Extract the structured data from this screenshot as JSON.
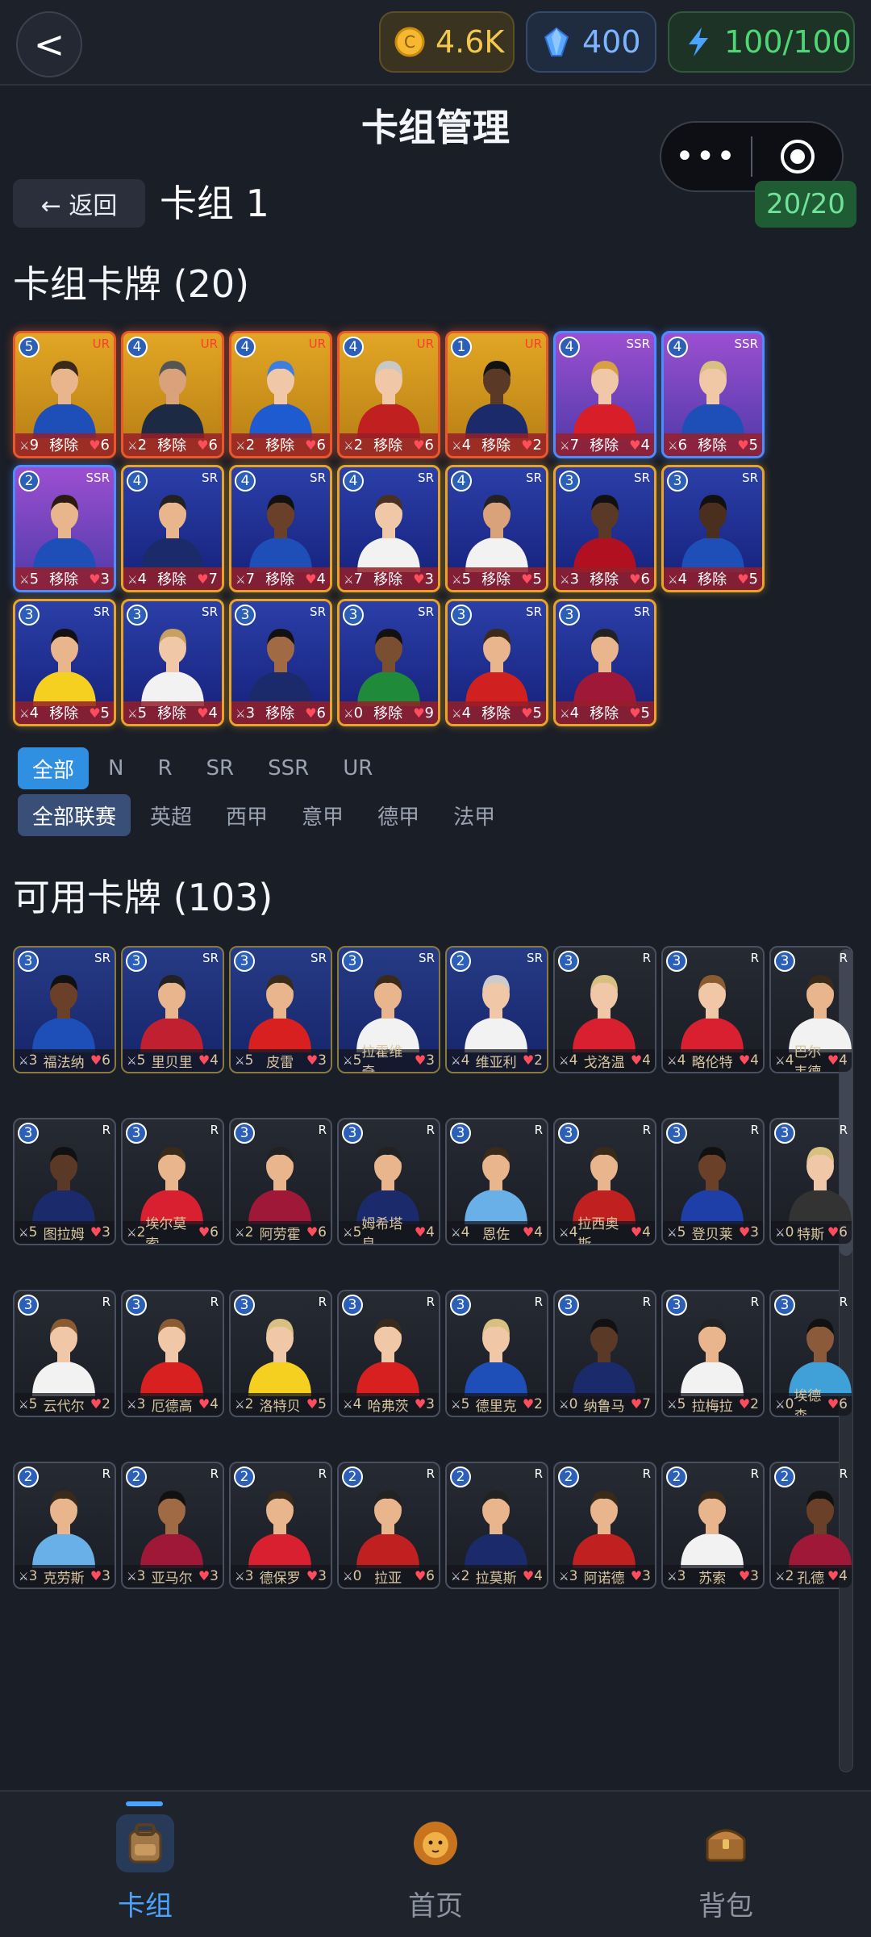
{
  "topbar": {
    "back_icon": "<",
    "coins": "4.6K",
    "gems": "400",
    "energy": "100/100"
  },
  "title": "卡组管理",
  "capsule": {
    "more": "•••"
  },
  "deck_header": {
    "return_label": "← 返回",
    "deck_name": "卡组 1",
    "count": "20/20"
  },
  "deck_section_title": "卡组卡牌 (20)",
  "available_section_title": "可用卡牌 (103)",
  "deck_cards": [
    {
      "level": "5",
      "rarity": "UR",
      "atk": "9",
      "action": "移除",
      "hp": "6",
      "jersey": "#1e4fb8",
      "skin": "#e8b58c",
      "hair": "#3a2a1a"
    },
    {
      "level": "4",
      "rarity": "UR",
      "atk": "2",
      "action": "移除",
      "hp": "6",
      "jersey": "#1c2a44",
      "skin": "#d9a27a",
      "hair": "#555555"
    },
    {
      "level": "4",
      "rarity": "UR",
      "atk": "2",
      "action": "移除",
      "hp": "6",
      "jersey": "#1f5bd0",
      "skin": "#f0c8a8",
      "hair": "#3d7fe0"
    },
    {
      "level": "4",
      "rarity": "UR",
      "atk": "2",
      "action": "移除",
      "hp": "6",
      "jersey": "#c0201f",
      "skin": "#f0c8a8",
      "hair": "#c8c8c8"
    },
    {
      "level": "1",
      "rarity": "UR",
      "atk": "4",
      "action": "移除",
      "hp": "2",
      "jersey": "#1a2a6a",
      "skin": "#5a3a26",
      "hair": "#111111"
    },
    {
      "level": "4",
      "rarity": "SSR",
      "atk": "7",
      "action": "移除",
      "hp": "4",
      "jersey": "#d81e28",
      "skin": "#f0c8a8",
      "hair": "#d8a040"
    },
    {
      "level": "4",
      "rarity": "SSR",
      "atk": "6",
      "action": "移除",
      "hp": "5",
      "jersey": "#1e4fb8",
      "skin": "#f0c8a8",
      "hair": "#d8c080"
    },
    {
      "level": "2",
      "rarity": "SSR",
      "atk": "5",
      "action": "移除",
      "hp": "3",
      "jersey": "#1e4fb8",
      "skin": "#e8b58c",
      "hair": "#2a1a10"
    },
    {
      "level": "4",
      "rarity": "SR",
      "atk": "4",
      "action": "移除",
      "hp": "7",
      "jersey": "#1a2a6a",
      "skin": "#e8b58c",
      "hair": "#222222"
    },
    {
      "level": "4",
      "rarity": "SR",
      "atk": "7",
      "action": "移除",
      "hp": "4",
      "jersey": "#1e4fb8",
      "skin": "#6a4028",
      "hair": "#111111"
    },
    {
      "level": "4",
      "rarity": "SR",
      "atk": "7",
      "action": "移除",
      "hp": "3",
      "jersey": "#f2f2f2",
      "skin": "#f0c8a8",
      "hair": "#4a3020"
    },
    {
      "level": "4",
      "rarity": "SR",
      "atk": "5",
      "action": "移除",
      "hp": "5",
      "jersey": "#f2f2f2",
      "skin": "#d9a27a",
      "hair": "#222222"
    },
    {
      "level": "3",
      "rarity": "SR",
      "atk": "3",
      "action": "移除",
      "hp": "6",
      "jersey": "#b01020",
      "skin": "#5a3a26",
      "hair": "#111111"
    },
    {
      "level": "3",
      "rarity": "SR",
      "atk": "4",
      "action": "移除",
      "hp": "5",
      "jersey": "#1e4fb8",
      "skin": "#4a2e1e",
      "hair": "#111111"
    },
    {
      "level": "3",
      "rarity": "SR",
      "atk": "4",
      "action": "移除",
      "hp": "5",
      "jersey": "#f5d020",
      "skin": "#e8b58c",
      "hair": "#111111"
    },
    {
      "level": "3",
      "rarity": "SR",
      "atk": "5",
      "action": "移除",
      "hp": "4",
      "jersey": "#f2f2f2",
      "skin": "#f0c8a8",
      "hair": "#c8a060"
    },
    {
      "level": "3",
      "rarity": "SR",
      "atk": "3",
      "action": "移除",
      "hp": "6",
      "jersey": "#1a2a6a",
      "skin": "#a06a44",
      "hair": "#111111"
    },
    {
      "level": "3",
      "rarity": "SR",
      "atk": "0",
      "action": "移除",
      "hp": "9",
      "jersey": "#1f8a3a",
      "skin": "#7a4e30",
      "hair": "#111111"
    },
    {
      "level": "3",
      "rarity": "SR",
      "atk": "4",
      "action": "移除",
      "hp": "5",
      "jersey": "#d02020",
      "skin": "#e8b58c",
      "hair": "#3a2a1a"
    },
    {
      "level": "3",
      "rarity": "SR",
      "atk": "4",
      "action": "移除",
      "hp": "5",
      "jersey": "#a01838",
      "skin": "#e8b58c",
      "hair": "#222222"
    }
  ],
  "rarity_filters": [
    "全部",
    "N",
    "R",
    "SR",
    "SSR",
    "UR"
  ],
  "league_filters": [
    "全部联赛",
    "英超",
    "西甲",
    "意甲",
    "德甲",
    "法甲"
  ],
  "available_cards": [
    {
      "level": "3",
      "rarity": "SR",
      "atk": "3",
      "name": "福法纳",
      "hp": "6",
      "jersey": "#1e4fb8",
      "skin": "#6a4028",
      "hair": "#111111"
    },
    {
      "level": "3",
      "rarity": "SR",
      "atk": "5",
      "name": "里贝里",
      "hp": "4",
      "jersey": "#c02030",
      "skin": "#e8b58c",
      "hair": "#222222"
    },
    {
      "level": "3",
      "rarity": "SR",
      "atk": "5",
      "name": "皮雷",
      "hp": "3",
      "jersey": "#d82020",
      "skin": "#e8b58c",
      "hair": "#3a2a1a"
    },
    {
      "level": "3",
      "rarity": "SR",
      "atk": "5",
      "name": "拉霍维奇",
      "hp": "3",
      "jersey": "#f2f2f2",
      "skin": "#e8b58c",
      "hair": "#3a2a1a"
    },
    {
      "level": "2",
      "rarity": "SR",
      "atk": "4",
      "name": "维亚利",
      "hp": "2",
      "jersey": "#f2f2f2",
      "skin": "#f0c8a8",
      "hair": "#cccccc"
    },
    {
      "level": "3",
      "rarity": "R",
      "atk": "4",
      "name": "戈洛温",
      "hp": "4",
      "jersey": "#d82030",
      "skin": "#f0c8a8",
      "hair": "#d8c080"
    },
    {
      "level": "3",
      "rarity": "R",
      "atk": "4",
      "name": "略伦特",
      "hp": "4",
      "jersey": "#d82030",
      "skin": "#f0c8a8",
      "hair": "#8a5a30"
    },
    {
      "level": "3",
      "rarity": "R",
      "atk": "4",
      "name": "巴尔韦德",
      "hp": "4",
      "jersey": "#f2f2f2",
      "skin": "#e8b58c",
      "hair": "#3a2a1a"
    },
    {
      "level": "3",
      "rarity": "R",
      "atk": "5",
      "name": "图拉姆",
      "hp": "3",
      "jersey": "#1a2a6a",
      "skin": "#5a3a26",
      "hair": "#111111"
    },
    {
      "level": "3",
      "rarity": "R",
      "atk": "2",
      "name": "埃尔莫索",
      "hp": "6",
      "jersey": "#d82030",
      "skin": "#e8b58c",
      "hair": "#3a2a1a"
    },
    {
      "level": "3",
      "rarity": "R",
      "atk": "2",
      "name": "阿劳霍",
      "hp": "6",
      "jersey": "#a01838",
      "skin": "#e8b58c",
      "hair": "#222222"
    },
    {
      "level": "3",
      "rarity": "R",
      "atk": "5",
      "name": "姆希塔良",
      "hp": "4",
      "jersey": "#1a2a6a",
      "skin": "#e8b58c",
      "hair": "#222222"
    },
    {
      "level": "3",
      "rarity": "R",
      "atk": "4",
      "name": "恩佐",
      "hp": "4",
      "jersey": "#6ab0e8",
      "skin": "#e8b58c",
      "hair": "#3a2a1a"
    },
    {
      "level": "3",
      "rarity": "R",
      "atk": "4",
      "name": "拉西奥斯",
      "hp": "4",
      "jersey": "#c02020",
      "skin": "#e8b58c",
      "hair": "#3a2a1a"
    },
    {
      "level": "3",
      "rarity": "R",
      "atk": "5",
      "name": "登贝莱",
      "hp": "3",
      "jersey": "#1e3fa8",
      "skin": "#6a4028",
      "hair": "#111111"
    },
    {
      "level": "3",
      "rarity": "R",
      "atk": "0",
      "name": "特斯",
      "hp": "6",
      "jersey": "#333333",
      "skin": "#f0c8a8",
      "hair": "#d8c080"
    },
    {
      "level": "3",
      "rarity": "R",
      "atk": "5",
      "name": "云代尔",
      "hp": "2",
      "jersey": "#f2f2f2",
      "skin": "#f0c8a8",
      "hair": "#8a5a30"
    },
    {
      "level": "3",
      "rarity": "R",
      "atk": "3",
      "name": "厄德高",
      "hp": "4",
      "jersey": "#d82020",
      "skin": "#f0c8a8",
      "hair": "#8a5a30"
    },
    {
      "level": "3",
      "rarity": "R",
      "atk": "2",
      "name": "洛特贝",
      "hp": "5",
      "jersey": "#f5d020",
      "skin": "#f0c8a8",
      "hair": "#d8c080"
    },
    {
      "level": "3",
      "rarity": "R",
      "atk": "4",
      "name": "哈弗茨",
      "hp": "3",
      "jersey": "#d82020",
      "skin": "#f0c8a8",
      "hair": "#3a2a1a"
    },
    {
      "level": "3",
      "rarity": "R",
      "atk": "5",
      "name": "德里克",
      "hp": "2",
      "jersey": "#1e4fb8",
      "skin": "#f0c8a8",
      "hair": "#d8c080"
    },
    {
      "level": "3",
      "rarity": "R",
      "atk": "0",
      "name": "纳鲁马",
      "hp": "7",
      "jersey": "#1a2a6a",
      "skin": "#5a3a26",
      "hair": "#111111"
    },
    {
      "level": "3",
      "rarity": "R",
      "atk": "5",
      "name": "拉梅拉",
      "hp": "2",
      "jersey": "#f2f2f2",
      "skin": "#e8b58c",
      "hair": "#222222"
    },
    {
      "level": "3",
      "rarity": "R",
      "atk": "0",
      "name": "埃德森",
      "hp": "6",
      "jersey": "#40a0d8",
      "skin": "#8a5a3a",
      "hair": "#111111"
    },
    {
      "level": "2",
      "rarity": "R",
      "atk": "3",
      "name": "克劳斯",
      "hp": "3",
      "jersey": "#6ab0e8",
      "skin": "#e8b58c",
      "hair": "#3a2a1a"
    },
    {
      "level": "2",
      "rarity": "R",
      "atk": "3",
      "name": "亚马尔",
      "hp": "3",
      "jersey": "#a01838",
      "skin": "#a06a44",
      "hair": "#111111"
    },
    {
      "level": "2",
      "rarity": "R",
      "atk": "3",
      "name": "德保罗",
      "hp": "3",
      "jersey": "#d82030",
      "skin": "#e8b58c",
      "hair": "#3a2a1a"
    },
    {
      "level": "2",
      "rarity": "R",
      "atk": "0",
      "name": "拉亚",
      "hp": "6",
      "jersey": "#c02020",
      "skin": "#e8b58c",
      "hair": "#222222"
    },
    {
      "level": "2",
      "rarity": "R",
      "atk": "2",
      "name": "拉莫斯",
      "hp": "4",
      "jersey": "#1a2a6a",
      "skin": "#e8b58c",
      "hair": "#222222"
    },
    {
      "level": "2",
      "rarity": "R",
      "atk": "3",
      "name": "阿诺德",
      "hp": "3",
      "jersey": "#c02020",
      "skin": "#e8b58c",
      "hair": "#3a2a1a"
    },
    {
      "level": "2",
      "rarity": "R",
      "atk": "3",
      "name": "苏索",
      "hp": "3",
      "jersey": "#f2f2f2",
      "skin": "#e8b58c",
      "hair": "#3a2a1a"
    },
    {
      "level": "2",
      "rarity": "R",
      "atk": "2",
      "name": "孔德",
      "hp": "4",
      "jersey": "#a01838",
      "skin": "#6a4028",
      "hair": "#111111"
    }
  ],
  "tabs": [
    {
      "label": "卡组",
      "icon": "backpack-icon"
    },
    {
      "label": "首页",
      "icon": "lion-icon"
    },
    {
      "label": "背包",
      "icon": "chest-icon"
    }
  ],
  "colors": {
    "accent": "#4aa3ff",
    "ur_border": "#e8582c",
    "ssr_border": "#4d8cff",
    "sr_border": "#e7a428",
    "heart": "#ff4d5e"
  }
}
